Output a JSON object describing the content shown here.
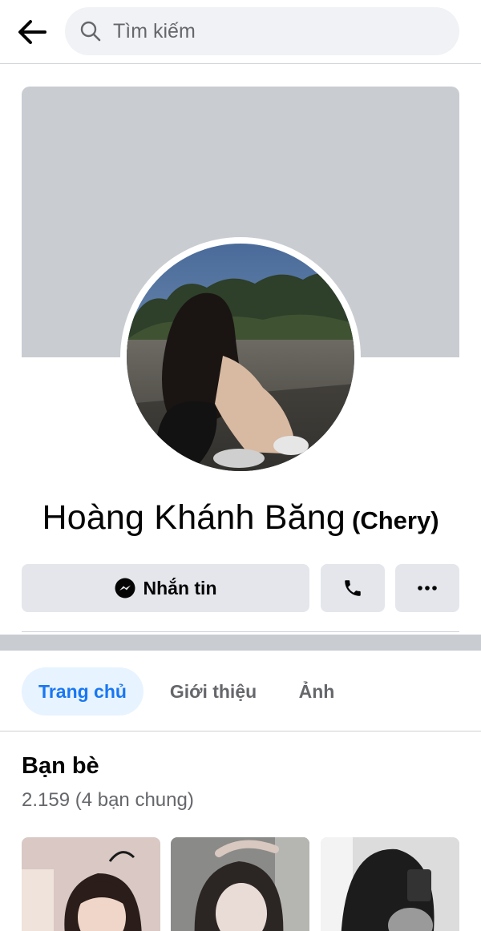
{
  "header": {
    "search_placeholder": "Tìm kiếm",
    "icons": [
      "back-arrow-icon",
      "search-icon"
    ]
  },
  "profile": {
    "name": "Hoàng Khánh Băng",
    "alternate_name": "(Chery)"
  },
  "actions": {
    "message_label": "Nhắn tin",
    "icons": [
      "messenger-icon",
      "phone-icon",
      "more-icon"
    ]
  },
  "tabs": [
    {
      "label": "Trang chủ",
      "active": true
    },
    {
      "label": "Giới thiệu",
      "active": false
    },
    {
      "label": "Ảnh",
      "active": false
    }
  ],
  "friends": {
    "title": "Bạn bè",
    "count_text": "2.159 (4 bạn chung)"
  },
  "colors": {
    "accent": "#1877f2",
    "accent_bg": "#e7f3ff",
    "button_bg": "#e4e6eb",
    "cover_bg": "#c9ccd1",
    "secondary_text": "#65676b"
  }
}
